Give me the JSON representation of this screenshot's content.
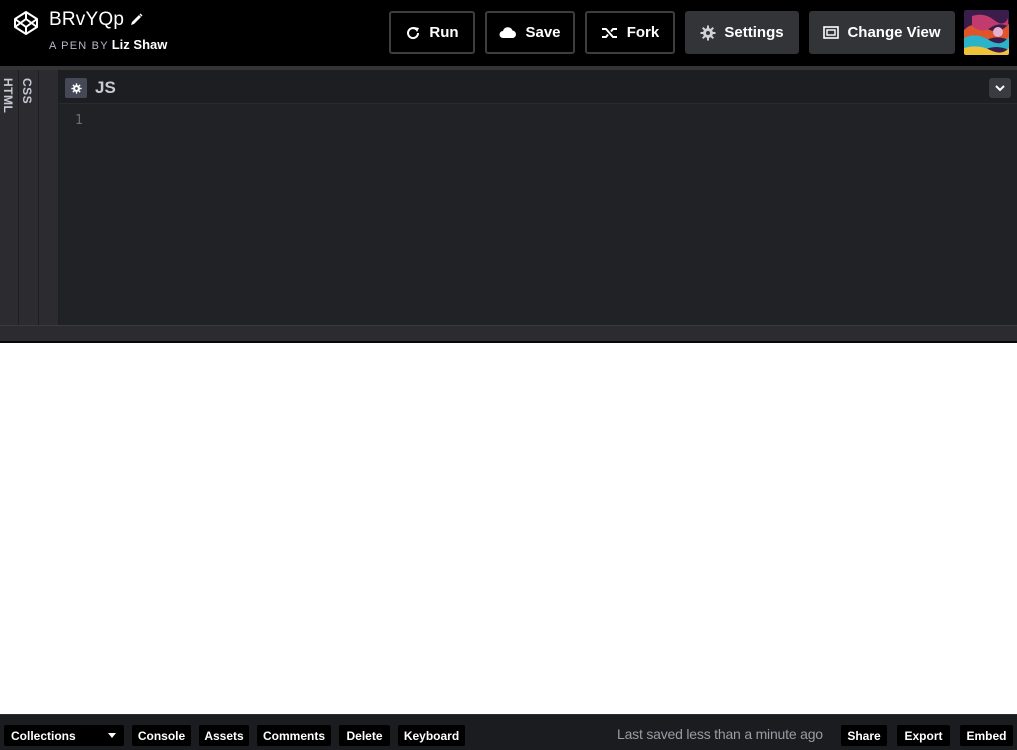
{
  "header": {
    "pen_title": "BRvYQp",
    "byline_prefix": "A PEN BY",
    "author": "Liz Shaw",
    "buttons": {
      "run": "Run",
      "save": "Save",
      "fork": "Fork",
      "settings": "Settings",
      "change_view": "Change View"
    }
  },
  "editor": {
    "tabs": {
      "html": "HTML",
      "css": "CSS"
    },
    "js_pane": {
      "title": "JS",
      "line_number": "1"
    }
  },
  "footer": {
    "collections": "Collections",
    "buttons": {
      "console": "Console",
      "assets": "Assets",
      "comments": "Comments",
      "delete": "Delete",
      "keyboard": "Keyboard",
      "share": "Share",
      "export": "Export",
      "embed": "Embed"
    },
    "status": "Last saved less than a minute ago"
  },
  "icons": {
    "logo": "codepen-logo-icon",
    "edit": "pencil-icon",
    "run": "refresh-icon",
    "save": "cloud-icon",
    "fork": "fork-icon",
    "settings": "gear-icon",
    "change_view": "window-icon",
    "js_settings": "gear-icon",
    "js_collapse": "chevron-down-icon"
  }
}
